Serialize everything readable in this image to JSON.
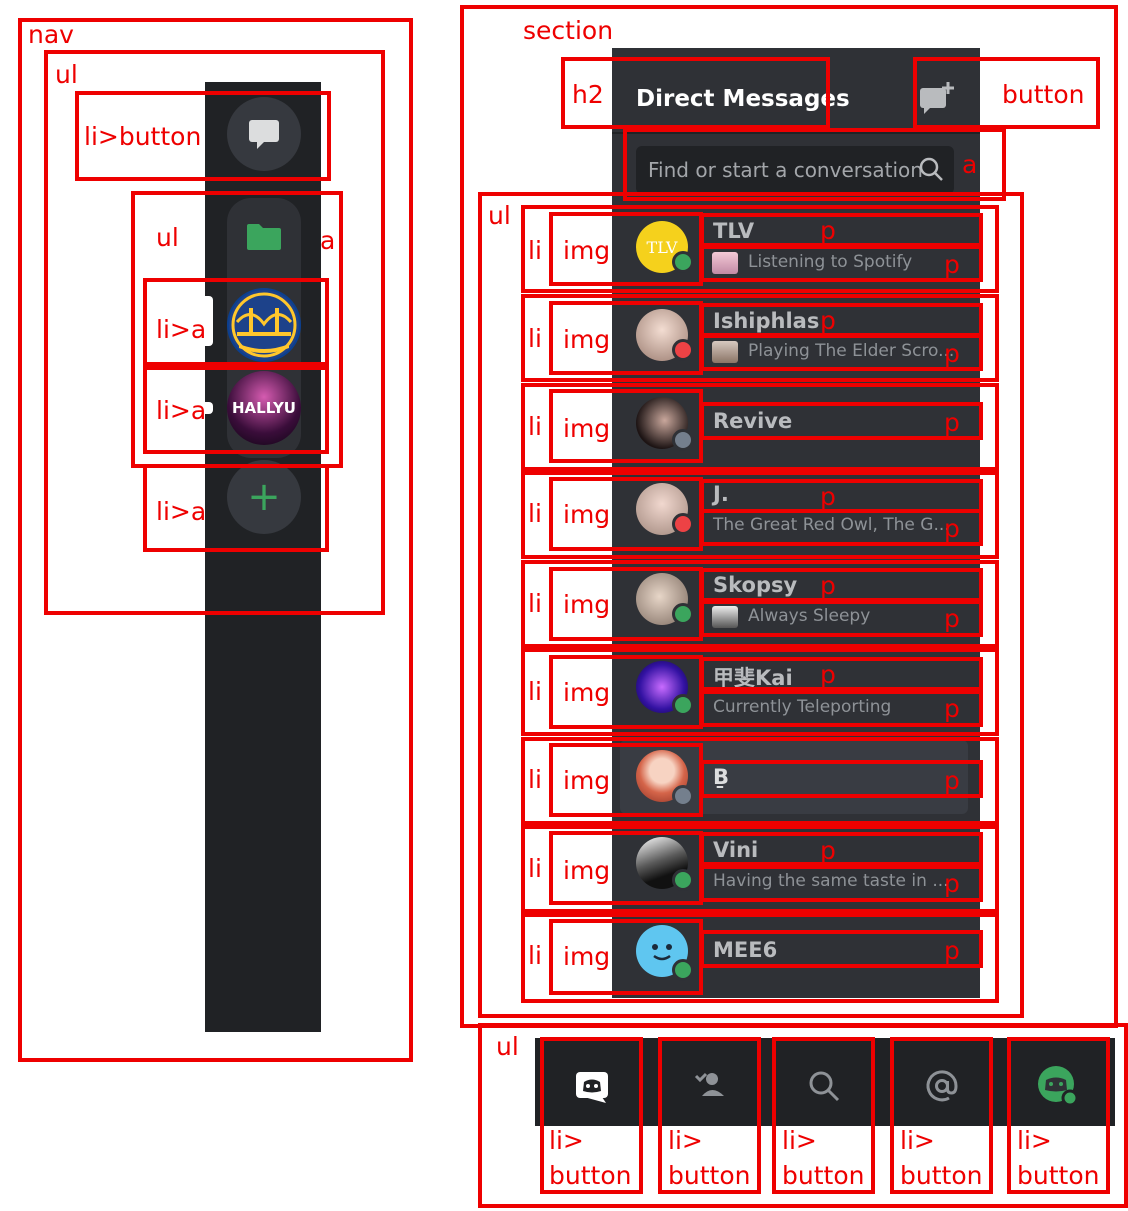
{
  "annotation_labels": {
    "nav": "nav",
    "ul": "ul",
    "li_button": "li>button",
    "li_a": "li>a",
    "a": "a",
    "section": "section",
    "h2": "h2",
    "button": "button",
    "li": "li",
    "img": "img",
    "p": "p",
    "li_arrow": "li>",
    "button_word": "button"
  },
  "server_rail": {
    "hallyu_text": "HALLYU",
    "add_symbol": "+",
    "icons": [
      "chat-bubble-icon",
      "folder-icon",
      "golden-state-warriors-logo",
      "hallyu-server-icon",
      "plus-icon"
    ]
  },
  "dm_panel": {
    "title": "Direct Messages",
    "search_placeholder": "Find or start a conversation",
    "conversations": [
      {
        "name": "TLV",
        "subtitle": "Listening to Spotify",
        "status": "online",
        "avatar_text": "TLV"
      },
      {
        "name": "Ishiphlas",
        "subtitle": "Playing The Elder Scro...",
        "status": "dnd"
      },
      {
        "name": "Revive",
        "subtitle": "",
        "status": "offline"
      },
      {
        "name": "J.",
        "subtitle": "The Great Red Owl, The G...",
        "status": "dnd"
      },
      {
        "name": "Skopsy",
        "subtitle": "Always Sleepy",
        "status": "online"
      },
      {
        "name": "甲斐Kai",
        "subtitle": "Currently Teleporting",
        "status": "online"
      },
      {
        "name": "Ḇ",
        "subtitle": "",
        "status": "offline"
      },
      {
        "name": "Vini",
        "subtitle": "Having the same taste in ...",
        "status": "online"
      },
      {
        "name": "MEE6",
        "subtitle": "",
        "status": "online"
      }
    ]
  },
  "tab_bar": {
    "icons": [
      "discord-home-icon",
      "friends-icon",
      "search-icon",
      "mentions-icon",
      "profile-icon"
    ]
  },
  "colors": {
    "annotation": "#ee0000",
    "rail": "#202225",
    "panel": "#2f3136",
    "online": "#3ba55d",
    "dnd": "#ed4245",
    "offline": "#747f8d"
  }
}
